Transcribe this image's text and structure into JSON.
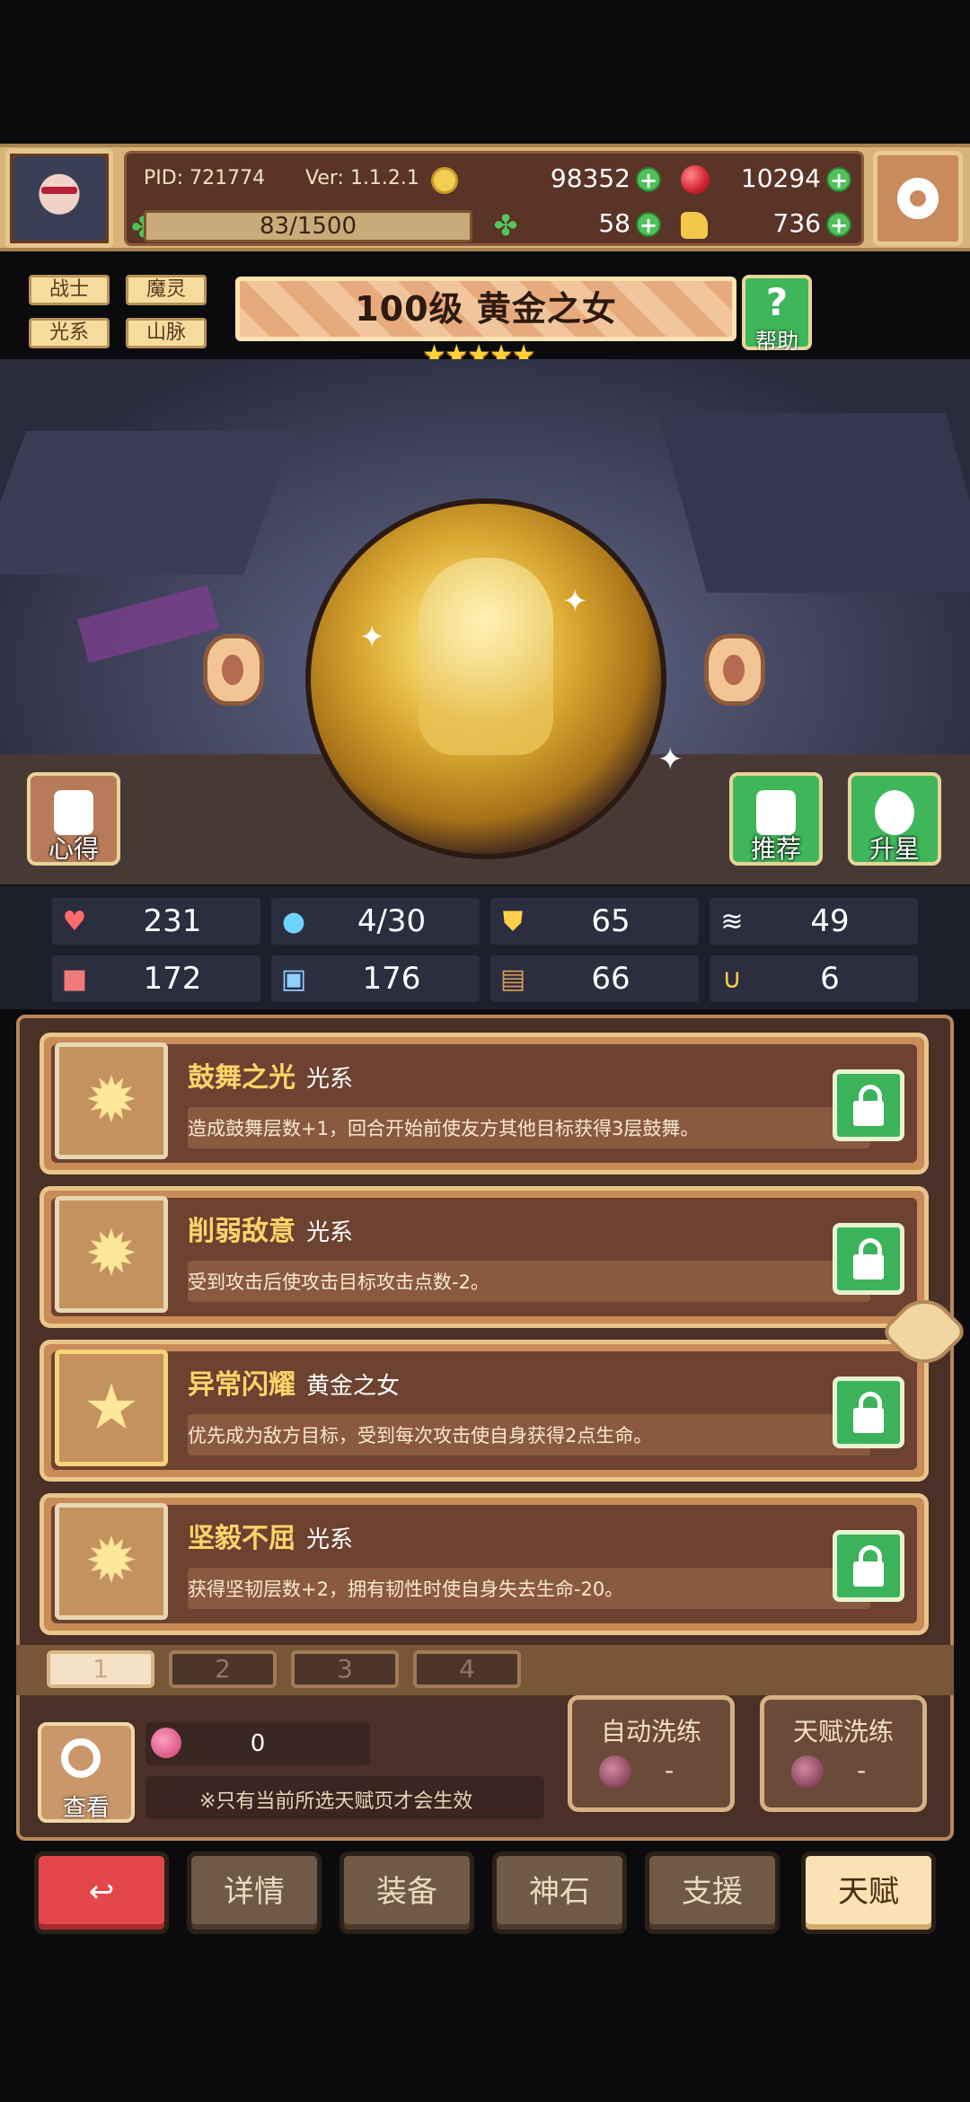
{
  "header": {
    "pid": "PID: 721774",
    "version": "Ver: 1.1.2.1",
    "energy": "83/1500",
    "coins": "98352",
    "rubies": "10294",
    "clovers": "58",
    "bags": "736"
  },
  "tags": [
    "战士",
    "魔灵",
    "光系",
    "山脉"
  ],
  "hero": {
    "title": "100级 黄金之女",
    "stars": "★★★★★",
    "help_label": "帮助"
  },
  "scene_buttons": {
    "notes": "心得",
    "recommend": "推荐",
    "star_up": "升星"
  },
  "stats": [
    {
      "icon": "heart-icon",
      "value": "231"
    },
    {
      "icon": "drop-icon",
      "value": "4/30"
    },
    {
      "icon": "shield-icon",
      "value": "65"
    },
    {
      "icon": "wing-icon",
      "value": "49"
    },
    {
      "icon": "fist-icon",
      "value": "172"
    },
    {
      "icon": "book-icon",
      "value": "176"
    },
    {
      "icon": "boots-icon",
      "value": "66"
    },
    {
      "icon": "horseshoe-icon",
      "value": "6"
    }
  ],
  "talents": [
    {
      "name": "鼓舞之光",
      "type": "光系",
      "desc": "造成鼓舞层数+1，回合开始前使友方其他目标获得3层鼓舞。",
      "icon": "sun-icon"
    },
    {
      "name": "削弱敌意",
      "type": "光系",
      "desc": "受到攻击后使攻击目标攻击点数-2。",
      "icon": "sun-icon"
    },
    {
      "name": "异常闪耀",
      "type": "黄金之女",
      "desc": "优先成为敌方目标，受到每次攻击使自身获得2点生命。",
      "icon": "star-icon"
    },
    {
      "name": "坚毅不屈",
      "type": "光系",
      "desc": "获得坚韧层数+2，拥有韧性时使自身失去生命-20。",
      "icon": "sun-icon"
    }
  ],
  "pages": [
    "1",
    "2",
    "3",
    "4"
  ],
  "bottom": {
    "view_label": "查看",
    "fruit_count": "0",
    "note": "※只有当前所选天赋页才会生效",
    "auto_wash": "自动洗练",
    "auto_wash_cost": "-",
    "talent_wash": "天赋洗练",
    "talent_wash_cost": "-"
  },
  "nav": {
    "back_symbol": "↩",
    "details": "详情",
    "equip": "装备",
    "godstone": "神石",
    "support": "支援",
    "talent": "天赋"
  }
}
